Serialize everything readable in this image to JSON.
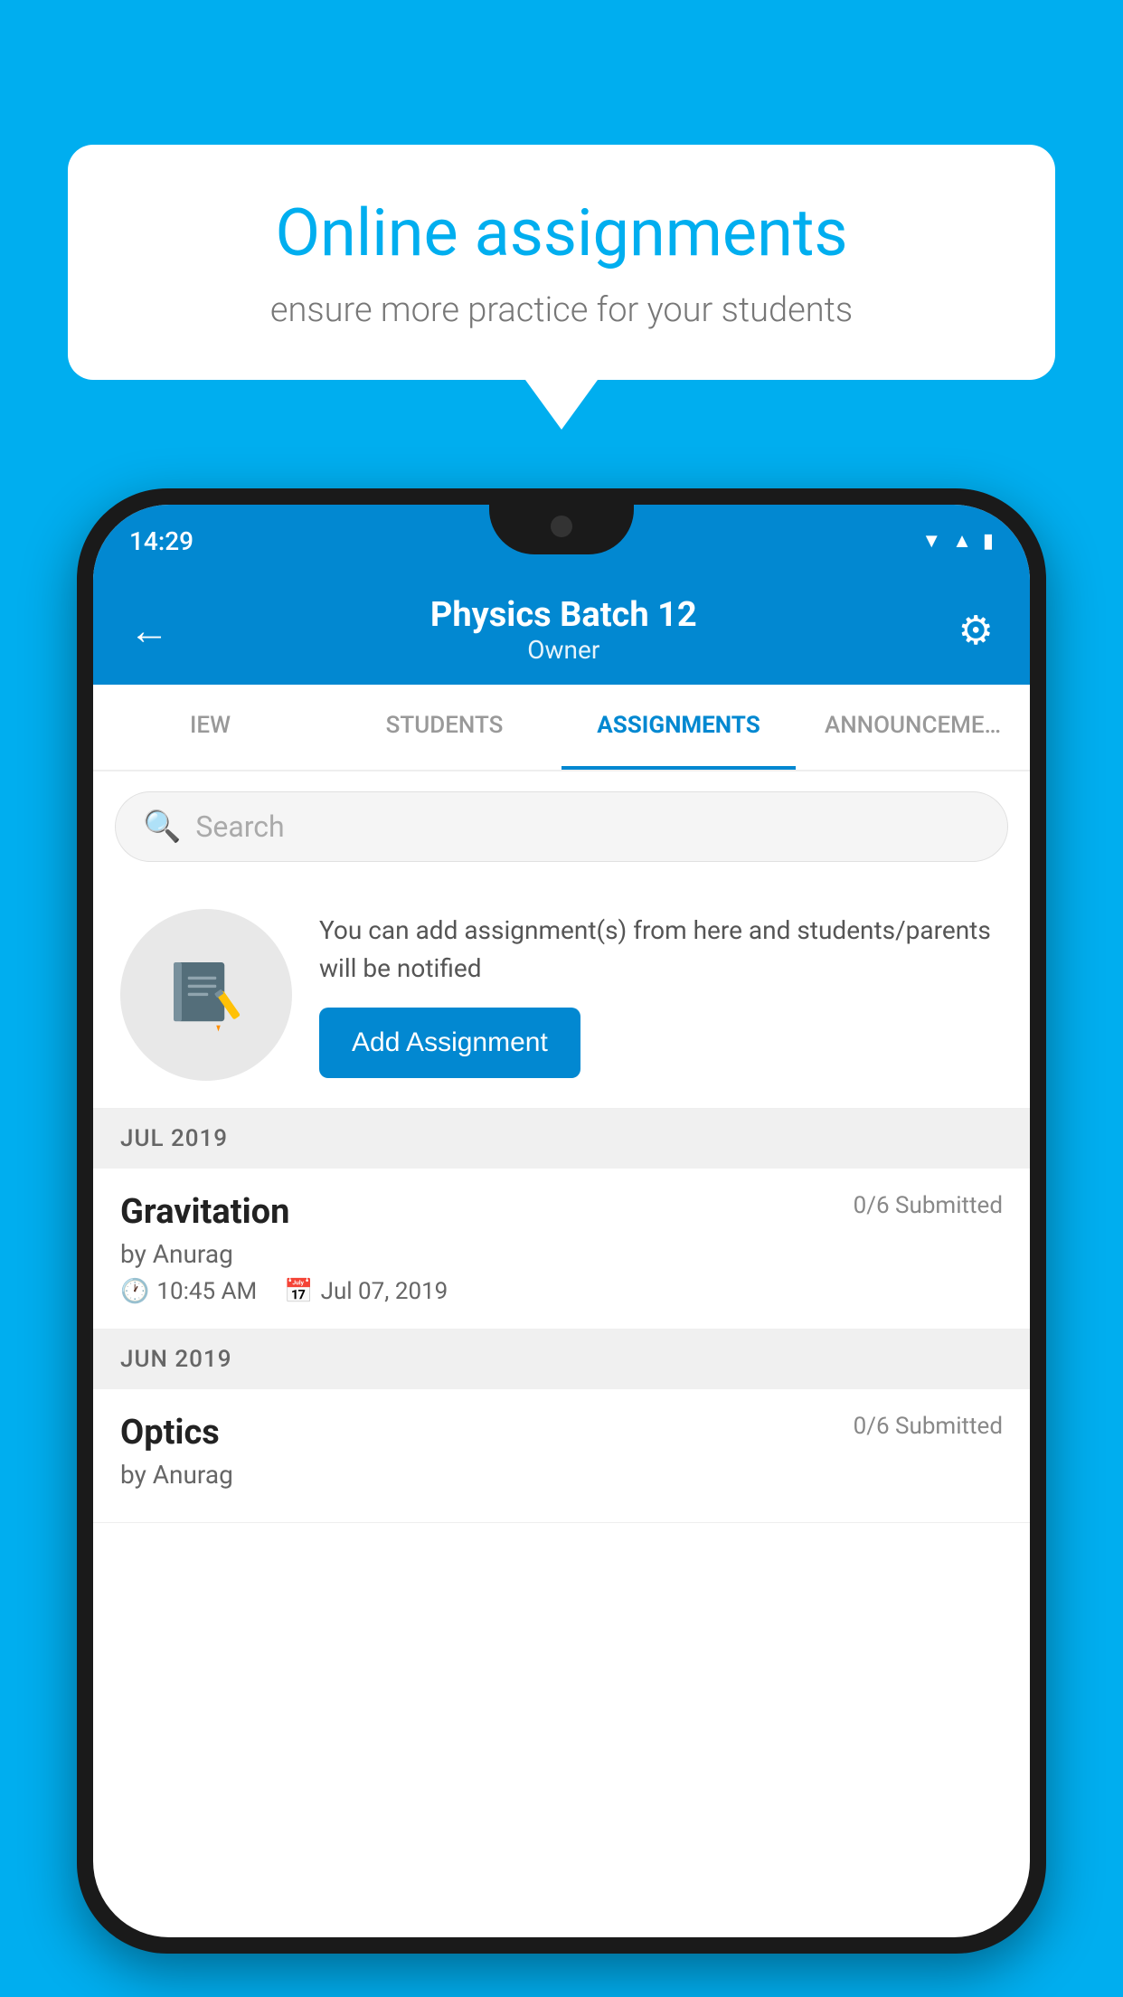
{
  "background_color": "#00AEEF",
  "speech_bubble": {
    "title": "Online assignments",
    "subtitle": "ensure more practice for your students"
  },
  "status_bar": {
    "time": "14:29",
    "icons": [
      "wifi",
      "signal",
      "battery"
    ]
  },
  "header": {
    "title": "Physics Batch 12",
    "subtitle": "Owner"
  },
  "tabs": [
    {
      "label": "IEW",
      "active": false
    },
    {
      "label": "STUDENTS",
      "active": false
    },
    {
      "label": "ASSIGNMENTS",
      "active": true
    },
    {
      "label": "ANNOUNCEMENTS",
      "active": false
    }
  ],
  "search": {
    "placeholder": "Search"
  },
  "add_assignment_section": {
    "description": "You can add assignment(s) from here and students/parents will be notified",
    "button_label": "Add Assignment"
  },
  "sections": [
    {
      "label": "JUL 2019",
      "assignments": [
        {
          "name": "Gravitation",
          "submitted": "0/6 Submitted",
          "by": "by Anurag",
          "time": "10:45 AM",
          "date": "Jul 07, 2019"
        }
      ]
    },
    {
      "label": "JUN 2019",
      "assignments": [
        {
          "name": "Optics",
          "submitted": "0/6 Submitted",
          "by": "by Anurag",
          "time": "",
          "date": ""
        }
      ]
    }
  ]
}
